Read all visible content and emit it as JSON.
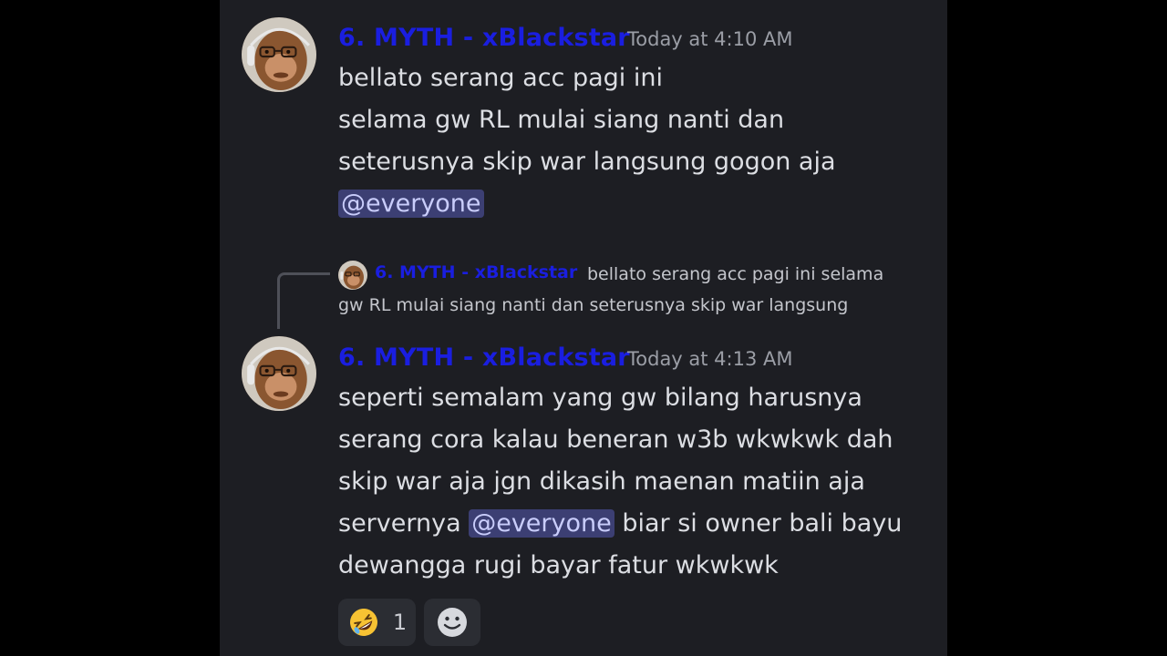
{
  "messages": [
    {
      "author": "6. MYTH - xBlackstar",
      "timestamp": "Today at 4:10 AM",
      "lines": [
        "bellato serang acc pagi ini",
        "selama gw RL mulai siang nanti dan",
        "seterusnya skip war langsung gogon aja"
      ],
      "mention": "@everyone"
    },
    {
      "reply": {
        "author": "6. MYTH - xBlackstar",
        "text_line1": "bellato serang acc pagi ini selama",
        "text_line2": "gw RL mulai siang nanti dan seterusnya skip war langsung"
      },
      "author": "6. MYTH - xBlackstar",
      "timestamp": "Today at 4:13 AM",
      "lines": [
        "seperti semalam yang gw bilang harusnya",
        "serang cora kalau beneran w3b wkwkwk dah",
        "skip war aja jgn dikasih maenan matiin aja"
      ],
      "line4_before": "servernya ",
      "mention": "@everyone",
      "line4_after": " biar si owner bali bayu",
      "line5": "dewangga rugi bayar fatur wkwkwk",
      "reactions": [
        {
          "emoji": "rolling-on-floor-laughing-emoji",
          "count": "1"
        },
        {
          "emoji": "add-reaction-icon"
        }
      ]
    }
  ],
  "colors": {
    "author": "#1a1ee0",
    "background": "#1d1e23",
    "mention_bg": "#3c3f73"
  }
}
